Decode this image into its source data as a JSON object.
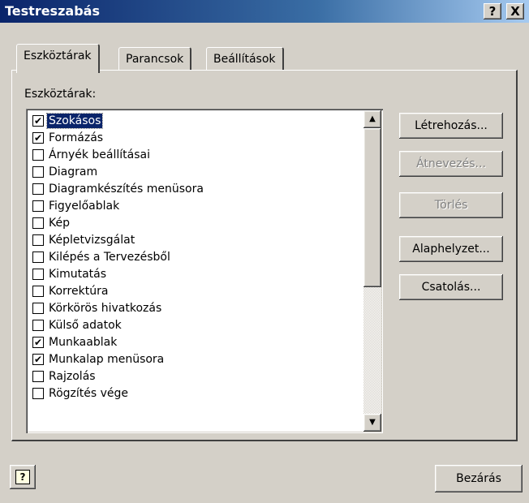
{
  "window": {
    "title": "Testreszabás",
    "help_btn": "?",
    "close_btn": "X"
  },
  "tabs": [
    {
      "label": "Eszköztárak",
      "active": true
    },
    {
      "label": "Parancsok",
      "active": false
    },
    {
      "label": "Beállítások",
      "active": false
    }
  ],
  "list_label": "Eszköztárak:",
  "toolbars": [
    {
      "label": "Szokásos",
      "checked": true,
      "selected": true
    },
    {
      "label": "Formázás",
      "checked": true
    },
    {
      "label": "Árnyék beállításai",
      "checked": false
    },
    {
      "label": "Diagram",
      "checked": false
    },
    {
      "label": "Diagramkészítés menüsora",
      "checked": false
    },
    {
      "label": "Figyelőablak",
      "checked": false
    },
    {
      "label": "Kép",
      "checked": false
    },
    {
      "label": "Képletvizsgálat",
      "checked": false
    },
    {
      "label": "Kilépés a Tervezésből",
      "checked": false
    },
    {
      "label": "Kimutatás",
      "checked": false
    },
    {
      "label": "Korrektúra",
      "checked": false
    },
    {
      "label": "Körkörös hivatkozás",
      "checked": false
    },
    {
      "label": "Külső adatok",
      "checked": false
    },
    {
      "label": "Munkaablak",
      "checked": true
    },
    {
      "label": "Munkalap menüsora",
      "checked": true
    },
    {
      "label": "Rajzolás",
      "checked": false
    },
    {
      "label": "Rögzítés vége",
      "checked": false
    }
  ],
  "buttons": {
    "new": "Létrehozás...",
    "rename": "Átnevezés...",
    "delete": "Törlés",
    "reset": "Alaphelyzet...",
    "attach": "Csatolás...",
    "close": "Bezárás"
  },
  "icons": {
    "help": "question-mark-icon",
    "scroll_up": "up-arrow-icon",
    "scroll_down": "down-arrow-icon"
  }
}
